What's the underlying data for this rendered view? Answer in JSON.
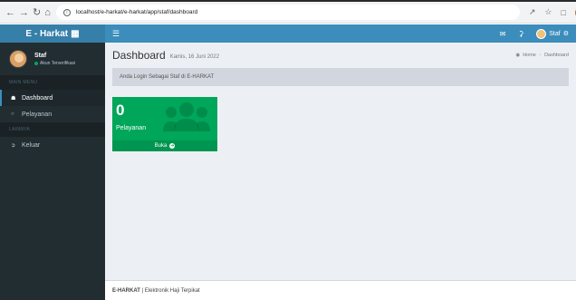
{
  "browser": {
    "url": "localhost/e-harkat/e-harkat/app/staf/dashboard"
  },
  "header": {
    "logo_text": "E - Harkat",
    "user_name": "Staf"
  },
  "sidebar": {
    "user_name": "Staf",
    "user_status": "Akun Terverifikasi",
    "section_main": "MAIN MENU",
    "section_other": "LAINNYA",
    "items": [
      {
        "label": "Dashboard"
      },
      {
        "label": "Pelayanan"
      },
      {
        "label": "Keluar"
      }
    ]
  },
  "content": {
    "title": "Dashboard",
    "subtitle": "Kamis, 16 Juni 2022",
    "breadcrumb_home": "Home",
    "breadcrumb_current": "Dashboard",
    "callout_text": "Anda Login Sebagai Staf di E-HARKAT"
  },
  "stat_box": {
    "count": "0",
    "label": "Pelayanan",
    "footer": "Buka",
    "color": "#00a65a"
  },
  "footer": {
    "brand": "E-HARKAT",
    "separator": " | ",
    "text": "Elektronik Haji Terpikat"
  }
}
